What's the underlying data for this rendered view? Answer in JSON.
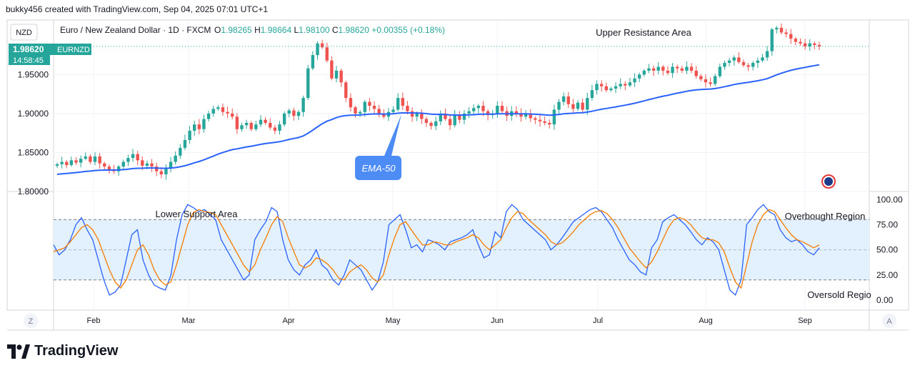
{
  "header": {
    "credit": "bukky456 created with TradingView.com, Sep 04, 2025 07:01 UTC+1",
    "currency": "NZD",
    "legend": "Euro / New Zealand Dollar · 1D · FXCM",
    "ohlc": {
      "o_label": "O",
      "o": "1.98265",
      "h_label": "H",
      "h": "1.98664",
      "l_label": "L",
      "l": "1.98100",
      "c_label": "C",
      "c": "1.98620",
      "change": "+0.00355 (+0.18%)"
    }
  },
  "price_badge": {
    "price": "1.98620",
    "symbol": "EURNZD",
    "countdown": "14:58:45"
  },
  "annotations": {
    "upper_resistance": "Upper Resistance Area",
    "lower_support": "Lower Support Area",
    "overbought": "Overbought Region",
    "oversold": "Oversold Regio",
    "ema_callout": "EMA-50"
  },
  "footer": {
    "left_button": "Z",
    "right_button": "A",
    "brand": "TradingView"
  },
  "colors": {
    "up": "#26a69a",
    "down": "#ef5350",
    "ema": "#2962ff",
    "stoch_k": "#2962ff",
    "stoch_d": "#f57c00",
    "band": "#e3f0fd",
    "callout": "#4e8cf5"
  },
  "chart_data": [
    {
      "type": "candlestick",
      "symbol": "EURNZD",
      "y_ticks": [
        "1.80000",
        "1.85000",
        "1.90000",
        "1.95000"
      ],
      "ylim": [
        1.8,
        2.02
      ],
      "x_ticks": [
        "Feb",
        "Mar",
        "Apr",
        "May",
        "Jun",
        "Jul",
        "Aug",
        "Sep"
      ],
      "closes": [
        1.835,
        1.838,
        1.834,
        1.84,
        1.837,
        1.842,
        1.845,
        1.838,
        1.845,
        1.836,
        1.832,
        1.828,
        1.826,
        1.832,
        1.838,
        1.843,
        1.848,
        1.84,
        1.833,
        1.836,
        1.832,
        1.826,
        1.822,
        1.83,
        1.838,
        1.846,
        1.856,
        1.866,
        1.878,
        1.886,
        1.88,
        1.893,
        1.9,
        1.906,
        1.908,
        1.902,
        1.9,
        1.896,
        1.88,
        1.885,
        1.888,
        1.88,
        1.886,
        1.892,
        1.888,
        1.882,
        1.878,
        1.886,
        1.9,
        1.904,
        1.897,
        1.902,
        1.92,
        1.958,
        1.975,
        1.99,
        1.985,
        1.968,
        1.945,
        1.955,
        1.94,
        1.92,
        1.908,
        1.9,
        1.902,
        1.915,
        1.91,
        1.906,
        1.9,
        1.896,
        1.902,
        1.905,
        1.92,
        1.91,
        1.903,
        1.896,
        1.9,
        1.893,
        1.888,
        1.884,
        1.89,
        1.9,
        1.893,
        1.885,
        1.898,
        1.892,
        1.9,
        1.903,
        1.907,
        1.91,
        1.903,
        1.898,
        1.9,
        1.91,
        1.903,
        1.897,
        1.903,
        1.9,
        1.896,
        1.9,
        1.894,
        1.892,
        1.89,
        1.888,
        1.886,
        1.905,
        1.915,
        1.922,
        1.912,
        1.906,
        1.914,
        1.905,
        1.92,
        1.93,
        1.938,
        1.935,
        1.93,
        1.932,
        1.935,
        1.938,
        1.936,
        1.94,
        1.945,
        1.95,
        1.955,
        1.958,
        1.955,
        1.96,
        1.955,
        1.952,
        1.96,
        1.958,
        1.955,
        1.96,
        1.955,
        1.948,
        1.944,
        1.94,
        1.938,
        1.948,
        1.96,
        1.965,
        1.968,
        1.972,
        1.966,
        1.962,
        1.96,
        1.965,
        1.968,
        1.972,
        1.98,
        2.008,
        2.01,
        2.004,
        2.002,
        1.996,
        1.992,
        1.99,
        1.986,
        1.99,
        1.988,
        1.986
      ],
      "ema50_label": "EMA-50",
      "last_price": 1.9862
    },
    {
      "type": "line",
      "indicator": "Stochastic",
      "y_ticks": [
        "100.00",
        "75.00",
        "50.00",
        "25.00",
        "0.00"
      ],
      "ylim": [
        -10,
        108
      ],
      "overbought": 80,
      "oversold": 20,
      "series": [
        {
          "values": [
            55,
            45,
            50,
            60,
            75,
            82,
            70,
            60,
            40,
            20,
            5,
            8,
            15,
            40,
            65,
            70,
            40,
            25,
            15,
            12,
            10,
            25,
            60,
            85,
            95,
            92,
            88,
            90,
            85,
            80,
            60,
            50,
            40,
            30,
            20,
            25,
            60,
            70,
            78,
            92,
            88,
            60,
            40,
            30,
            25,
            35,
            40,
            50,
            35,
            30,
            20,
            15,
            25,
            40,
            35,
            30,
            20,
            10,
            18,
            38,
            75,
            80,
            85,
            70,
            52,
            55,
            48,
            60,
            58,
            55,
            50,
            58,
            60,
            62,
            65,
            70,
            55,
            42,
            45,
            68,
            62,
            88,
            95,
            90,
            80,
            75,
            70,
            65,
            60,
            50,
            55,
            62,
            70,
            78,
            82,
            86,
            90,
            92,
            88,
            80,
            72,
            60,
            50,
            40,
            35,
            28,
            25,
            52,
            60,
            78,
            82,
            85,
            80,
            75,
            68,
            60,
            55,
            62,
            58,
            50,
            30,
            10,
            5,
            20,
            75,
            82,
            90,
            95,
            88,
            85,
            70,
            62,
            58,
            60,
            55,
            48,
            45,
            52
          ]
        },
        {
          "values": [
            48,
            50,
            52,
            58,
            65,
            72,
            75,
            70,
            60,
            45,
            30,
            18,
            12,
            20,
            35,
            50,
            55,
            45,
            30,
            20,
            15,
            18,
            35,
            55,
            75,
            87,
            90,
            88,
            87,
            85,
            75,
            65,
            55,
            45,
            35,
            28,
            35,
            50,
            62,
            75,
            83,
            78,
            62,
            48,
            35,
            32,
            35,
            42,
            40,
            36,
            30,
            22,
            20,
            28,
            32,
            35,
            30,
            22,
            18,
            25,
            45,
            62,
            75,
            78,
            70,
            62,
            55,
            55,
            58,
            57,
            55,
            55,
            58,
            60,
            62,
            65,
            62,
            55,
            50,
            55,
            60,
            72,
            82,
            88,
            86,
            80,
            75,
            70,
            65,
            58,
            55,
            57,
            62,
            68,
            75,
            80,
            85,
            88,
            89,
            86,
            80,
            72,
            62,
            52,
            45,
            38,
            32,
            38,
            48,
            60,
            72,
            80,
            82,
            80,
            75,
            68,
            62,
            60,
            60,
            57,
            48,
            32,
            18,
            12,
            35,
            58,
            75,
            85,
            90,
            88,
            80,
            72,
            65,
            60,
            58,
            55,
            52,
            55
          ]
        }
      ]
    }
  ]
}
